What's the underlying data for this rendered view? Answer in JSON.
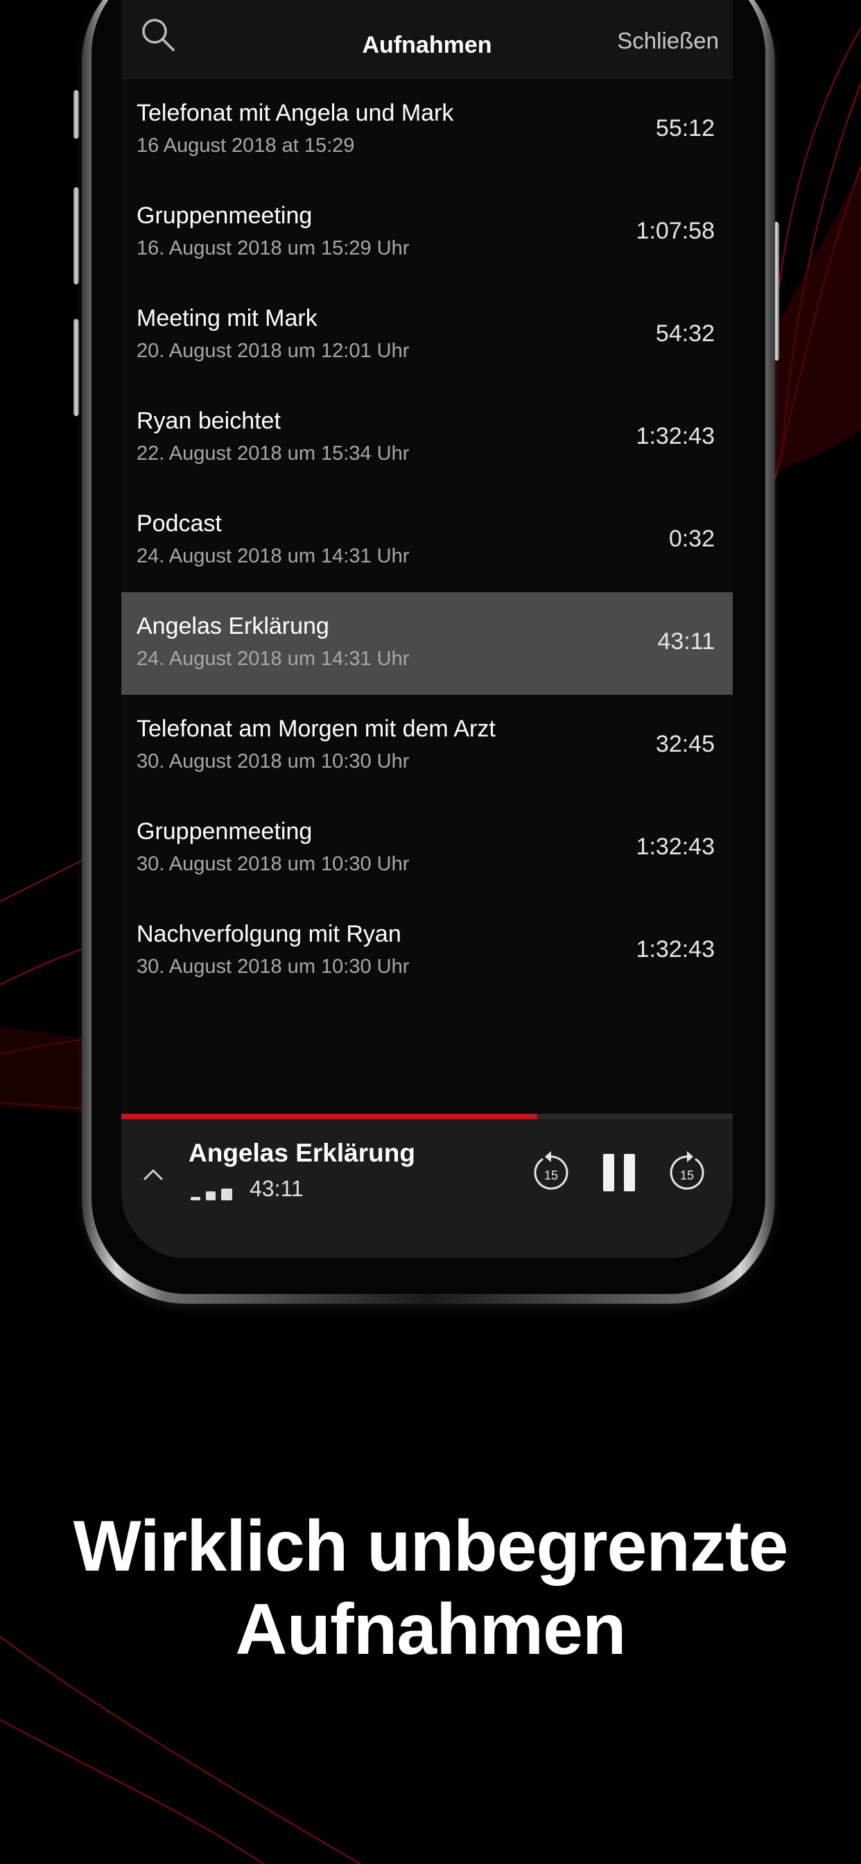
{
  "nav": {
    "search_icon": "search-icon",
    "title": "Aufnahmen",
    "close_label": "Schließen"
  },
  "recordings": [
    {
      "title": "Telefonat mit Angela und Mark",
      "date": "16 August 2018 at 15:29",
      "duration": "55:12",
      "active": false
    },
    {
      "title": "Gruppenmeeting",
      "date": "16. August 2018 um 15:29 Uhr",
      "duration": "1:07:58",
      "active": false
    },
    {
      "title": "Meeting mit Mark",
      "date": "20. August 2018 um 12:01 Uhr",
      "duration": "54:32",
      "active": false
    },
    {
      "title": "Ryan beichtet",
      "date": "22. August 2018 um 15:34 Uhr",
      "duration": "1:32:43",
      "active": false
    },
    {
      "title": "Podcast",
      "date": "24. August 2018 um 14:31 Uhr",
      "duration": "0:32",
      "active": false
    },
    {
      "title": "Angelas Erklärung",
      "date": "24. August 2018 um 14:31 Uhr",
      "duration": "43:11",
      "active": true
    },
    {
      "title": "Telefonat am Morgen mit dem Arzt",
      "date": "30. August 2018 um 10:30 Uhr",
      "duration": "32:45",
      "active": false
    },
    {
      "title": "Gruppenmeeting",
      "date": "30. August 2018 um 10:30 Uhr",
      "duration": "1:32:43",
      "active": false
    },
    {
      "title": "Nachverfolgung mit Ryan",
      "date": "30. August 2018 um 10:30 Uhr",
      "duration": "1:32:43",
      "active": false
    }
  ],
  "player": {
    "title": "Angelas Erklärung",
    "time": "43:11",
    "progress_fraction": 0.68,
    "skip_seconds": "15",
    "icons": [
      "chevron-up-icon",
      "waveform-icon",
      "skip-back-15-icon",
      "pause-icon",
      "skip-forward-15-icon"
    ]
  },
  "caption": {
    "line1": "Wirklich unbegrenzte",
    "line2": "Aufnahmen"
  },
  "colors": {
    "accent": "#c4161c",
    "background": "#000000",
    "active_row": "#4b4b4b"
  }
}
